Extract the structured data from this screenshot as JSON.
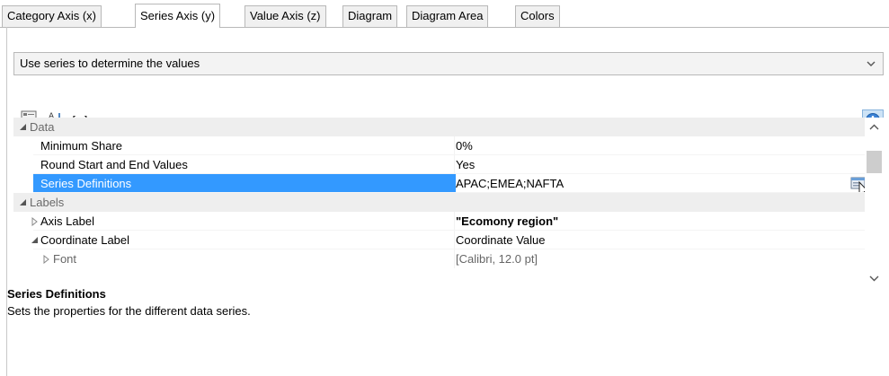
{
  "tabs": [
    {
      "label": "Category Axis (x)",
      "active": false
    },
    {
      "label": "Series Axis (y)",
      "active": true
    },
    {
      "label": "Value Axis (z)",
      "active": false
    },
    {
      "label": "Diagram",
      "active": false
    },
    {
      "label": "Diagram Area",
      "active": false
    },
    {
      "label": "Colors",
      "active": false
    }
  ],
  "dropdown": {
    "selected": "Use series to determine the values",
    "icon": "chevron-down-icon"
  },
  "toolbar": {
    "buttons": [
      {
        "icon": "categorized-view-icon"
      },
      {
        "icon": "sort-alphabetical-icon"
      },
      {
        "label": "[+]"
      }
    ],
    "info_icon": "info-icon",
    "accent": "#cde3f6"
  },
  "grid": {
    "rows": [
      {
        "type": "category",
        "name": "Data"
      },
      {
        "type": "property",
        "name": "Minimum Share",
        "value": "0%"
      },
      {
        "type": "property",
        "name": "Round Start and End Values",
        "value": "Yes"
      },
      {
        "type": "property",
        "name": "Series Definitions",
        "value": "APAC;EMEA;NAFTA",
        "selected": true
      },
      {
        "type": "category",
        "name": "Labels"
      },
      {
        "type": "property",
        "name": "Axis Label",
        "value": "\"Ecomony region\"",
        "collapsed": true,
        "bold": true
      },
      {
        "type": "property",
        "name": "Coordinate Label",
        "value": "Coordinate Value",
        "expanded": true
      },
      {
        "type": "property",
        "name": "Font",
        "value": "[Calibri, 12.0 pt]",
        "collapsed": true,
        "clipped": true
      }
    ],
    "selection_color": "#3399ff"
  },
  "description": {
    "title": "Series Definitions",
    "text": "Sets the properties for the different data series."
  }
}
